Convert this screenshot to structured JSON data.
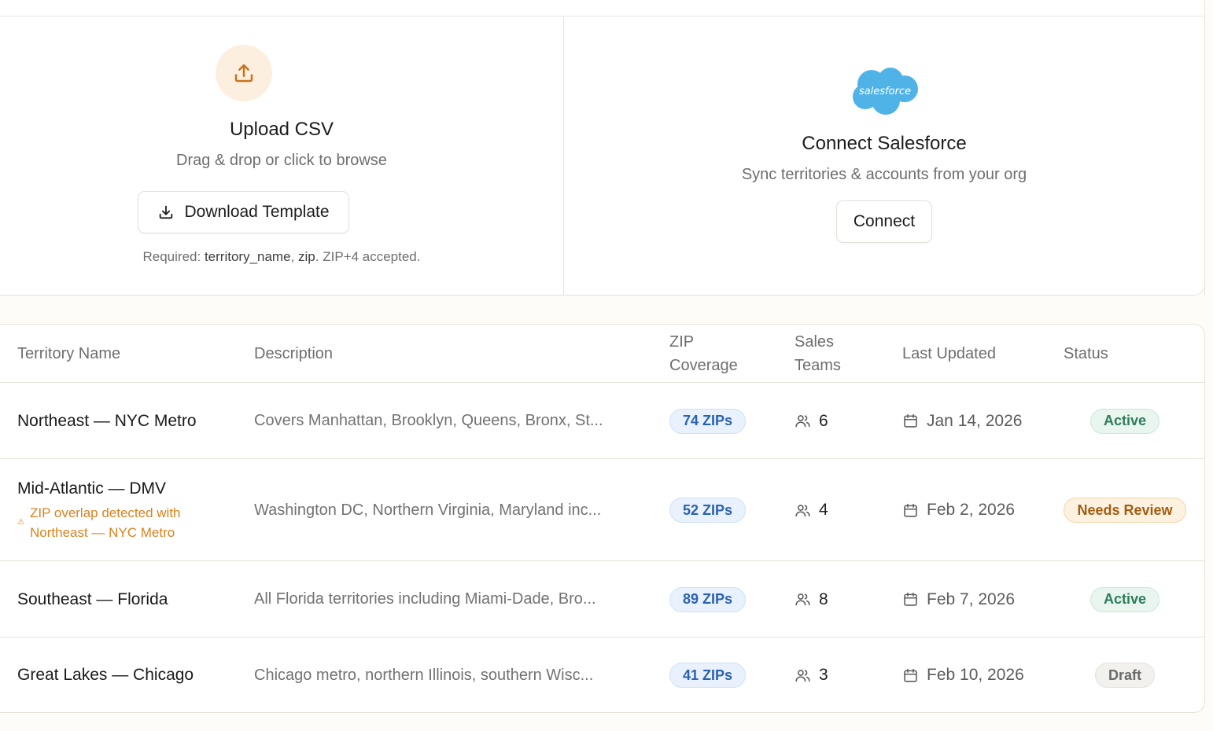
{
  "import": {
    "csv": {
      "icon": "upload-icon",
      "title": "Upload CSV",
      "subtitle": "Drag & drop or click to browse",
      "download_label": "Download Template",
      "download_icon": "download-icon",
      "note_prefix": "Required:",
      "note_field1": "territory_name",
      "note_sep": ",",
      "note_field2": "zip",
      "note_suffix": ". ZIP+4 accepted."
    },
    "salesforce": {
      "logo_text": "salesforce",
      "title": "Connect Salesforce",
      "subtitle": "Sync territories & accounts from your org",
      "connect_label": "Connect",
      "brand_color": "#4fb3e8"
    }
  },
  "table": {
    "headers": {
      "name": "Territory Name",
      "description": "Description",
      "zip_line1": "ZIP",
      "zip_line2": "Coverage",
      "teams_line1": "Sales",
      "teams_line2": "Teams",
      "updated": "Last Updated",
      "status": "Status"
    },
    "rows": [
      {
        "name": "Northeast — NYC Metro",
        "description": "Covers Manhattan, Brooklyn, Queens, Bronx, St...",
        "zips": "74 ZIPs",
        "teams": "6",
        "updated": "Jan 14, 2026",
        "status": "Active"
      },
      {
        "name": "Mid-Atlantic — DMV",
        "warning": "ZIP overlap detected with Northeast — NYC Metro",
        "warning_icon": "warning-icon",
        "description": "Washington DC, Northern Virginia, Maryland inc...",
        "zips": "52 ZIPs",
        "teams": "4",
        "updated": "Feb 2, 2026",
        "status": "Needs Review"
      },
      {
        "name": "Southeast — Florida",
        "description": "All Florida territories including Miami-Dade, Bro...",
        "zips": "89 ZIPs",
        "teams": "8",
        "updated": "Feb 7, 2026",
        "status": "Active"
      },
      {
        "name": "Great Lakes — Chicago",
        "description": "Chicago metro, northern Illinois, southern Wisc...",
        "zips": "41 ZIPs",
        "teams": "3",
        "updated": "Feb 10, 2026",
        "status": "Draft"
      }
    ]
  },
  "colors": {
    "accent_orange": "#d9821d",
    "zip_blue": "#2b62b0",
    "active_green": "#2e7c5a",
    "review_amber": "#a35d12"
  }
}
